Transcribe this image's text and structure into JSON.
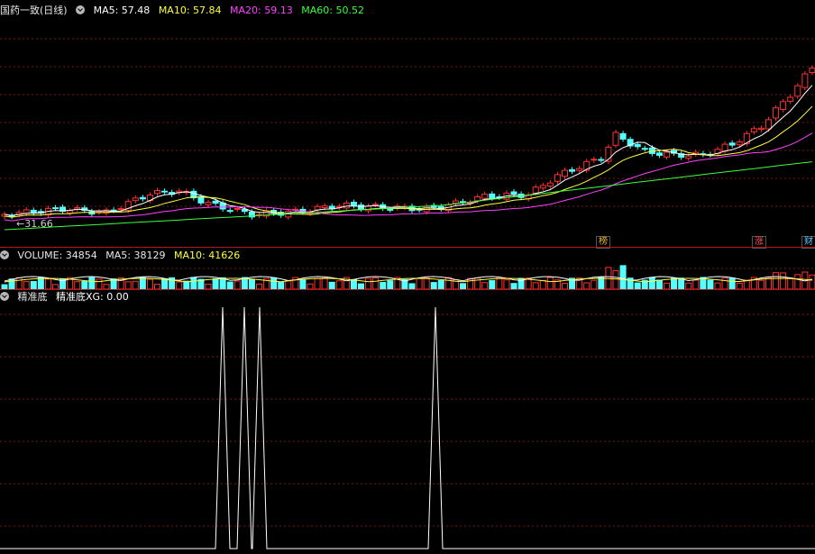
{
  "main": {
    "stock_title": "国药一致(日线)",
    "indicators": [
      {
        "label": "MA5: 57.48",
        "color": "#ffffff"
      },
      {
        "label": "MA10: 57.84",
        "color": "#ffff3c"
      },
      {
        "label": "MA20: 59.13",
        "color": "#ff40ff"
      },
      {
        "label": "MA60: 50.52",
        "color": "#3cff3c"
      }
    ],
    "low_price_label": "31.66",
    "badges": [
      {
        "text": "榜",
        "color": "#e8b030"
      },
      {
        "text": "涨",
        "color": "#ff5050"
      },
      {
        "text": "财",
        "color": "#60c8ff"
      }
    ]
  },
  "volume": {
    "label": "VOLUME: 34854",
    "ma5_label": "MA5: 38129",
    "ma10_label": "MA10: 41626"
  },
  "indicator_panel": {
    "name": "精准底",
    "value_label": "精准底XG: 0.00"
  },
  "colors": {
    "up": "#ff3232",
    "down": "#54ffff",
    "ma5": "#ffffff",
    "ma10": "#ffff3c",
    "ma20": "#ff40ff",
    "ma60": "#3cff3c",
    "grid": "#7a1a1a"
  }
}
